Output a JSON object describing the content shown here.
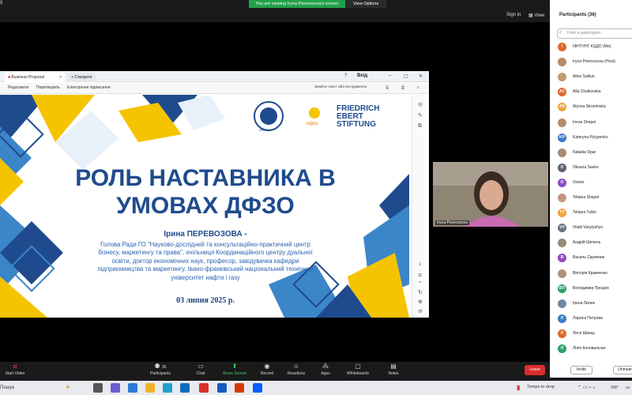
{
  "zoom": {
    "app_title": "g",
    "viewing_banner": "You are viewing Iryna Perevozova's screen",
    "view_options": "View Options",
    "sign_in": "Sign in",
    "view": "View",
    "leave": "Leave",
    "controls": {
      "start_video": "Start Video",
      "participants": "Participants",
      "participants_count": "36",
      "chat": "Chat",
      "share_screen": "Share Screen",
      "record": "Record",
      "reactions": "Reactions",
      "apps": "Apps",
      "whiteboards": "Whiteboards",
      "notes": "Notes"
    }
  },
  "browser": {
    "active_tab": "Business Proposal",
    "new_tab": "Створити",
    "exit_label": "Вхід",
    "toolbar": {
      "edit": "Редагувати",
      "convert": "Перетворить",
      "esign": "Електронне підписання",
      "search": "Знайти текст або інструменти"
    }
  },
  "slide": {
    "title_line1": "РОЛЬ НАСТАВНИКА В",
    "title_line2": "УМОВАХ ДФЗО",
    "author": "Ірина ПЕРЕВОЗОВА -",
    "description": "Голова Ради ГО \"Науково-дослідний та консультаційно-практичний центр бізнесу, маркетингу та права\", очільниця Координаційного центру дуальної освіти, доктор економічних наук, професор, завідувачка кафедри підприємництва та маркетингу. Івано-франківський національний технічний університет нафти і газу",
    "date": "03 липня 2025 р.",
    "logo_university": "ІФНТУНГ",
    "logo_npc": "НДКЦ",
    "logo_fes_line1": "FRIEDRICH",
    "logo_fes_line2": "EBERT",
    "logo_fes_line3": "STIFTUNG",
    "page_number": "1",
    "page_total": "11"
  },
  "video": {
    "name": "Iryna Perevozova"
  },
  "participants_panel": {
    "title": "Participants (36)",
    "search_placeholder": "Find a participant",
    "invite": "Invite",
    "unmute": "Unmute",
    "items": [
      {
        "name": "ІФНТУНГ КЦДО (Me)",
        "initials": "I",
        "color": "#e0662a"
      },
      {
        "name": "Iryna Perevozova (Host)",
        "initials": "",
        "color": "#b58a6a"
      },
      {
        "name": "Alina Salkun",
        "initials": "",
        "color": "#c59a76"
      },
      {
        "name": "Alla Chaikovska",
        "initials": "AC",
        "color": "#e0662a"
      },
      {
        "name": "Alyona Struminska",
        "initials": "AS",
        "color": "#f0a23b"
      },
      {
        "name": "Inesa Shepel",
        "initials": "",
        "color": "#b48b6e"
      },
      {
        "name": "Kateryna Pylypenko",
        "initials": "KP",
        "color": "#3b7bc4"
      },
      {
        "name": "Nataliia Opar",
        "initials": "",
        "color": "#a88a70"
      },
      {
        "name": "Oksana Savko",
        "initials": "O",
        "color": "#5c6470"
      },
      {
        "name": "Owner",
        "initials": "O",
        "color": "#8f4bc0"
      },
      {
        "name": "Tetiana Shepel",
        "initials": "",
        "color": "#c49580"
      },
      {
        "name": "Tetiana Tutko",
        "initials": "TT",
        "color": "#f0a23b"
      },
      {
        "name": "Vitalii Vasylyshyn",
        "initials": "VV",
        "color": "#6a7180"
      },
      {
        "name": "Андрій Шепель",
        "initials": "",
        "color": "#9a8a7a"
      },
      {
        "name": "Василь Скрипник",
        "initials": "В",
        "color": "#8f4bc0"
      },
      {
        "name": "Вікторія Кравченко",
        "initials": "",
        "color": "#b09078"
      },
      {
        "name": "Володимир Процюк",
        "initials": "ВП",
        "color": "#2ba06a"
      },
      {
        "name": "Ірина Лилик",
        "initials": "",
        "color": "#6c8aa8"
      },
      {
        "name": "Лариса Петрова",
        "initials": "Л",
        "color": "#3b7bc4"
      },
      {
        "name": "Леся Швець",
        "initials": "Л",
        "color": "#e0662a"
      },
      {
        "name": "Лілія Коновальчук",
        "initials": "Л",
        "color": "#2ba06a"
      }
    ]
  },
  "taskbar": {
    "search": "Пошук",
    "tray_text": "Temps to drop",
    "lang": "УКР",
    "time": "03"
  },
  "colors": {
    "slide_blue": "#1f4b8e",
    "slide_yellow": "#f5c400",
    "slide_light_blue": "#3b86c8",
    "zoom_green": "#23a04a",
    "leave_red": "#d92d2d"
  }
}
